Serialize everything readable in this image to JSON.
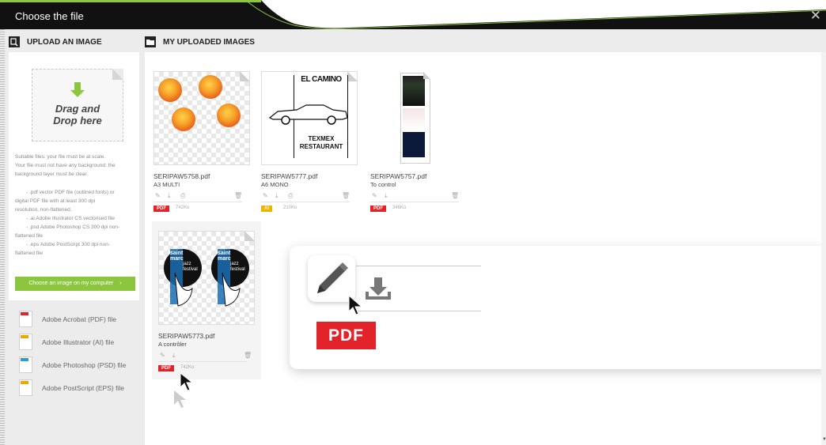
{
  "window": {
    "title": "Choose the file",
    "close_glyph": "✕",
    "accent_color": "#8cc63f"
  },
  "upload": {
    "heading": "UPLOAD AN IMAGE",
    "dropzone_text": "Drag and Drop here",
    "suitable_1": "Suitable files: your file must be at scale.",
    "suitable_2": "Your file must not have any background: the",
    "suitable_3": "background layer must be clear.",
    "pdf_1": "- .pdf vector PDF file (outlined fonts) or",
    "pdf_2": "digital PDF file with at least 300 dpi",
    "pdf_3": "resolution, non-flattened.",
    "ai_1": "- .ai Adobe Illustrator CS vectorised file",
    "psd_1": "- .psd Adobe Photoshop CS 300 dpi non-",
    "psd_2": "flattened file",
    "eps_1": "- .eps Adobe PostScript 300 dpi non-",
    "eps_2": "flattened file",
    "choose_button": "Choose an image on my computer"
  },
  "filetypes": [
    {
      "label": "Adobe Acrobat (PDF) file",
      "icon": "pdf-file-icon",
      "color": "#e2232a"
    },
    {
      "label": "Adobe Illustrator (AI) file",
      "icon": "ai-file-icon",
      "color": "#f0a500"
    },
    {
      "label": "Adobe Photoshop (PSD) file",
      "icon": "psd-file-icon",
      "color": "#2d9ad6"
    },
    {
      "label": "Adobe PostScript (EPS) file",
      "icon": "eps-file-icon",
      "color": "#f0a500"
    }
  ],
  "uploaded": {
    "heading": "MY UPLOADED IMAGES",
    "files": [
      {
        "name": "SERIPAW5758.pdf",
        "subtitle": "A3 MULTI",
        "format": "PDF",
        "format_color": "#e2232a",
        "size": "742Ko"
      },
      {
        "name": "SERIPAW5777.pdf",
        "subtitle": "A6 MONO",
        "format": "AI",
        "format_color": "#f0b400",
        "size": "210Ko"
      },
      {
        "name": "SERIPAW5757.pdf",
        "subtitle": "To control",
        "format": "PDF",
        "format_color": "#e2232a",
        "size": "346Ko"
      },
      {
        "name": "SERIPAW5773.pdf",
        "subtitle": "A contrôler",
        "format": "PDF",
        "format_color": "#e2232a",
        "size": "742Ko"
      }
    ]
  },
  "thumbnail_text": {
    "el_camino": "EL CAMINO",
    "texmex_1": "TEXMEX",
    "texmex_2": "RESTAURANT",
    "jazz_1": "saint",
    "jazz_2": "marc",
    "jazz_3": "jazz",
    "jazz_4": "festival"
  },
  "focus": {
    "format": "PDF"
  },
  "icons": {
    "edit": "pencil-icon",
    "download": "download-icon",
    "print": "print-icon",
    "delete": "trash-icon",
    "arrow_down": "arrow-down-icon",
    "chevron_right": "chevron-right-icon"
  }
}
